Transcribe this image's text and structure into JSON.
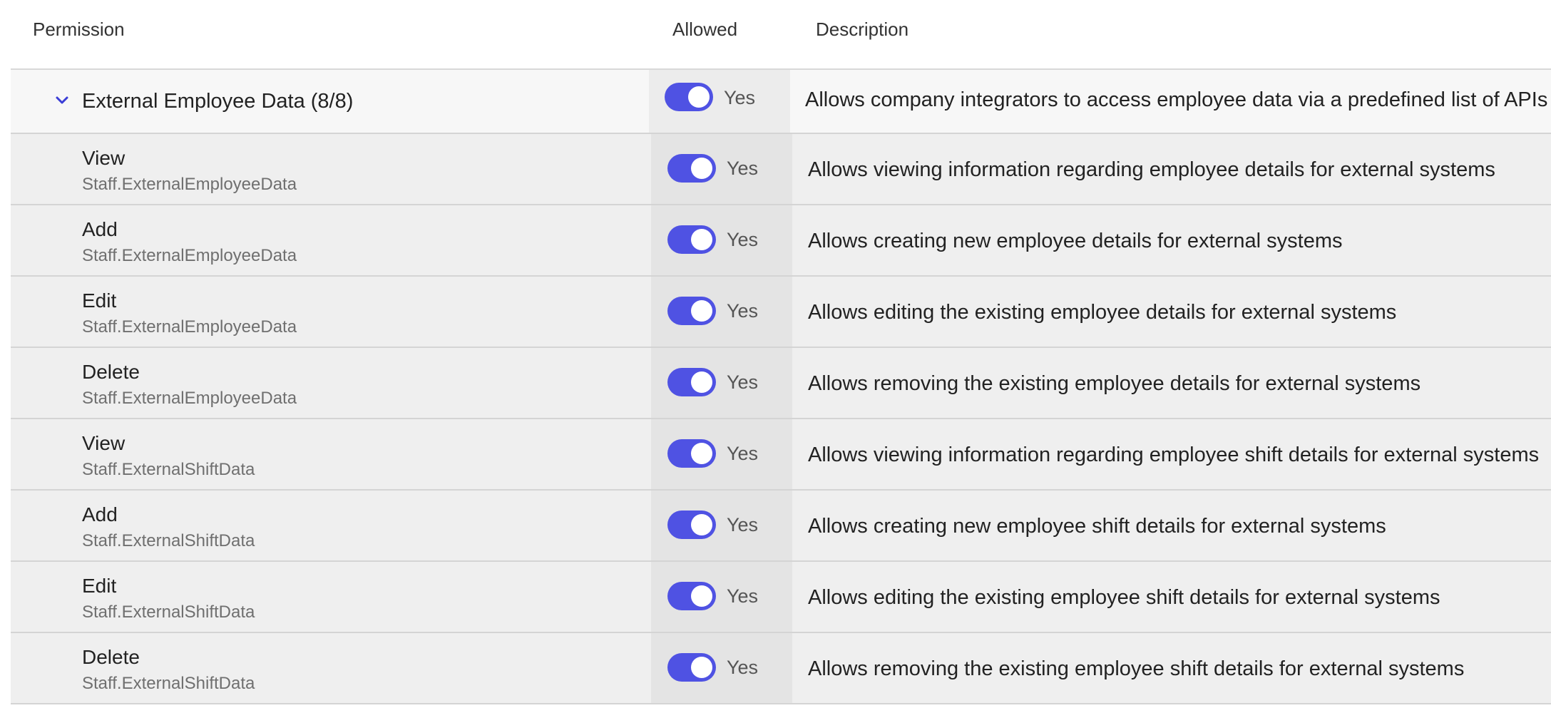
{
  "header": {
    "permission": "Permission",
    "allowed": "Allowed",
    "description": "Description"
  },
  "group": {
    "title": "External Employee Data (8/8)",
    "allowed_label": "Yes",
    "description": "Allows company integrators to access employee data via a predefined list of APIs",
    "expanded": true
  },
  "rows": [
    {
      "name": "View",
      "scope": "Staff.ExternalEmployeeData",
      "allowed_label": "Yes",
      "description": "Allows viewing information regarding employee details for external systems"
    },
    {
      "name": "Add",
      "scope": "Staff.ExternalEmployeeData",
      "allowed_label": "Yes",
      "description": "Allows creating new employee details for external systems"
    },
    {
      "name": "Edit",
      "scope": "Staff.ExternalEmployeeData",
      "allowed_label": "Yes",
      "description": "Allows editing the existing employee details for external systems"
    },
    {
      "name": "Delete",
      "scope": "Staff.ExternalEmployeeData",
      "allowed_label": "Yes",
      "description": "Allows removing the existing employee details for external systems"
    },
    {
      "name": "View",
      "scope": "Staff.ExternalShiftData",
      "allowed_label": "Yes",
      "description": "Allows viewing information regarding employee shift details for external systems"
    },
    {
      "name": "Add",
      "scope": "Staff.ExternalShiftData",
      "allowed_label": "Yes",
      "description": "Allows creating new employee shift details for external systems"
    },
    {
      "name": "Edit",
      "scope": "Staff.ExternalShiftData",
      "allowed_label": "Yes",
      "description": "Allows editing the existing employee shift details for external systems"
    },
    {
      "name": "Delete",
      "scope": "Staff.ExternalShiftData",
      "allowed_label": "Yes",
      "description": "Allows removing the existing employee shift details for external systems"
    }
  ],
  "colors": {
    "toggle_on": "#4f52e3",
    "chevron": "#3a3dd6"
  },
  "icons": {
    "group_toggle": "chevron-down-icon"
  }
}
